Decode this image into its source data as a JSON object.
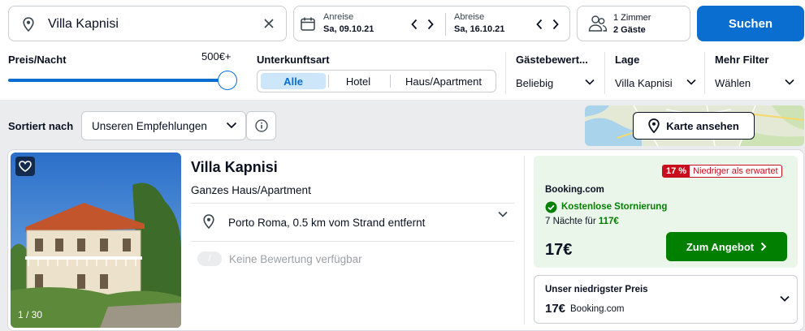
{
  "search": {
    "destination": "Villa Kapnisi",
    "checkin_label": "Anreise",
    "checkin_value": "Sa, 09.10.21",
    "checkout_label": "Abreise",
    "checkout_value": "Sa, 16.10.21",
    "rooms": "1 Zimmer",
    "guests": "2 Gäste",
    "search_label": "Suchen"
  },
  "filters": {
    "price_label": "Preis/Nacht",
    "price_value": "500€+",
    "price_fraction": 1.0,
    "type_label": "Unterkunftsart",
    "type_options": [
      "Alle",
      "Hotel",
      "Haus/Apartment"
    ],
    "type_selected": "Alle",
    "rating_label": "Gästebewert...",
    "rating_value": "Beliebig",
    "location_label": "Lage",
    "location_value": "Villa Kapnisi",
    "more_label": "Mehr Filter",
    "more_value": "Wählen"
  },
  "sort": {
    "label": "Sortiert nach",
    "value": "Unseren Empfehlungen"
  },
  "map": {
    "button_label": "Karte ansehen"
  },
  "hotel": {
    "name": "Villa Kapnisi",
    "type": "Ganzes Haus/Apartment",
    "location": "Porto Roma, 0.5 km vom Strand entfernt",
    "rating_badge": "/",
    "rating_text": "Keine Bewertung verfügbar",
    "photo_counter": "1 / 30"
  },
  "deal": {
    "discount": "17 %",
    "discount_text": "Niedriger als erwartet",
    "provider": "Booking.com",
    "cancellation": "Kostenlose Stornierung",
    "nights_prefix": "7 Nächte für",
    "nights_total": "117€",
    "price": "17€",
    "cta": "Zum Angebot"
  },
  "lowest": {
    "title": "Unser niedrigster Preis",
    "price": "17€",
    "provider": "Booking.com"
  },
  "colors": {
    "brand_blue": "#0a6ed1",
    "deal_green": "#007f00",
    "deal_bg": "#ebf6ea",
    "alert_red": "#c60e1c"
  }
}
